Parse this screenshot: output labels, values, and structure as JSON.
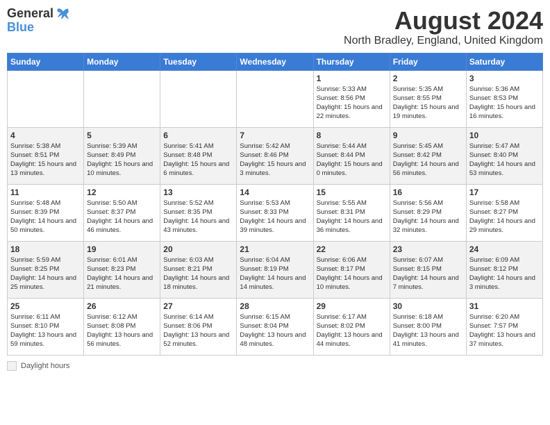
{
  "header": {
    "logo_general": "General",
    "logo_blue": "Blue",
    "month_title": "August 2024",
    "location": "North Bradley, England, United Kingdom"
  },
  "days_of_week": [
    "Sunday",
    "Monday",
    "Tuesday",
    "Wednesday",
    "Thursday",
    "Friday",
    "Saturday"
  ],
  "footer": {
    "daylight_label": "Daylight hours"
  },
  "weeks": [
    [
      {
        "day": "",
        "info": ""
      },
      {
        "day": "",
        "info": ""
      },
      {
        "day": "",
        "info": ""
      },
      {
        "day": "",
        "info": ""
      },
      {
        "day": "1",
        "info": "Sunrise: 5:33 AM\nSunset: 8:56 PM\nDaylight: 15 hours and 22 minutes."
      },
      {
        "day": "2",
        "info": "Sunrise: 5:35 AM\nSunset: 8:55 PM\nDaylight: 15 hours and 19 minutes."
      },
      {
        "day": "3",
        "info": "Sunrise: 5:36 AM\nSunset: 8:53 PM\nDaylight: 15 hours and 16 minutes."
      }
    ],
    [
      {
        "day": "4",
        "info": "Sunrise: 5:38 AM\nSunset: 8:51 PM\nDaylight: 15 hours and 13 minutes."
      },
      {
        "day": "5",
        "info": "Sunrise: 5:39 AM\nSunset: 8:49 PM\nDaylight: 15 hours and 10 minutes."
      },
      {
        "day": "6",
        "info": "Sunrise: 5:41 AM\nSunset: 8:48 PM\nDaylight: 15 hours and 6 minutes."
      },
      {
        "day": "7",
        "info": "Sunrise: 5:42 AM\nSunset: 8:46 PM\nDaylight: 15 hours and 3 minutes."
      },
      {
        "day": "8",
        "info": "Sunrise: 5:44 AM\nSunset: 8:44 PM\nDaylight: 15 hours and 0 minutes."
      },
      {
        "day": "9",
        "info": "Sunrise: 5:45 AM\nSunset: 8:42 PM\nDaylight: 14 hours and 56 minutes."
      },
      {
        "day": "10",
        "info": "Sunrise: 5:47 AM\nSunset: 8:40 PM\nDaylight: 14 hours and 53 minutes."
      }
    ],
    [
      {
        "day": "11",
        "info": "Sunrise: 5:48 AM\nSunset: 8:39 PM\nDaylight: 14 hours and 50 minutes."
      },
      {
        "day": "12",
        "info": "Sunrise: 5:50 AM\nSunset: 8:37 PM\nDaylight: 14 hours and 46 minutes."
      },
      {
        "day": "13",
        "info": "Sunrise: 5:52 AM\nSunset: 8:35 PM\nDaylight: 14 hours and 43 minutes."
      },
      {
        "day": "14",
        "info": "Sunrise: 5:53 AM\nSunset: 8:33 PM\nDaylight: 14 hours and 39 minutes."
      },
      {
        "day": "15",
        "info": "Sunrise: 5:55 AM\nSunset: 8:31 PM\nDaylight: 14 hours and 36 minutes."
      },
      {
        "day": "16",
        "info": "Sunrise: 5:56 AM\nSunset: 8:29 PM\nDaylight: 14 hours and 32 minutes."
      },
      {
        "day": "17",
        "info": "Sunrise: 5:58 AM\nSunset: 8:27 PM\nDaylight: 14 hours and 29 minutes."
      }
    ],
    [
      {
        "day": "18",
        "info": "Sunrise: 5:59 AM\nSunset: 8:25 PM\nDaylight: 14 hours and 25 minutes."
      },
      {
        "day": "19",
        "info": "Sunrise: 6:01 AM\nSunset: 8:23 PM\nDaylight: 14 hours and 21 minutes."
      },
      {
        "day": "20",
        "info": "Sunrise: 6:03 AM\nSunset: 8:21 PM\nDaylight: 14 hours and 18 minutes."
      },
      {
        "day": "21",
        "info": "Sunrise: 6:04 AM\nSunset: 8:19 PM\nDaylight: 14 hours and 14 minutes."
      },
      {
        "day": "22",
        "info": "Sunrise: 6:06 AM\nSunset: 8:17 PM\nDaylight: 14 hours and 10 minutes."
      },
      {
        "day": "23",
        "info": "Sunrise: 6:07 AM\nSunset: 8:15 PM\nDaylight: 14 hours and 7 minutes."
      },
      {
        "day": "24",
        "info": "Sunrise: 6:09 AM\nSunset: 8:12 PM\nDaylight: 14 hours and 3 minutes."
      }
    ],
    [
      {
        "day": "25",
        "info": "Sunrise: 6:11 AM\nSunset: 8:10 PM\nDaylight: 13 hours and 59 minutes."
      },
      {
        "day": "26",
        "info": "Sunrise: 6:12 AM\nSunset: 8:08 PM\nDaylight: 13 hours and 56 minutes."
      },
      {
        "day": "27",
        "info": "Sunrise: 6:14 AM\nSunset: 8:06 PM\nDaylight: 13 hours and 52 minutes."
      },
      {
        "day": "28",
        "info": "Sunrise: 6:15 AM\nSunset: 8:04 PM\nDaylight: 13 hours and 48 minutes."
      },
      {
        "day": "29",
        "info": "Sunrise: 6:17 AM\nSunset: 8:02 PM\nDaylight: 13 hours and 44 minutes."
      },
      {
        "day": "30",
        "info": "Sunrise: 6:18 AM\nSunset: 8:00 PM\nDaylight: 13 hours and 41 minutes."
      },
      {
        "day": "31",
        "info": "Sunrise: 6:20 AM\nSunset: 7:57 PM\nDaylight: 13 hours and 37 minutes."
      }
    ]
  ]
}
